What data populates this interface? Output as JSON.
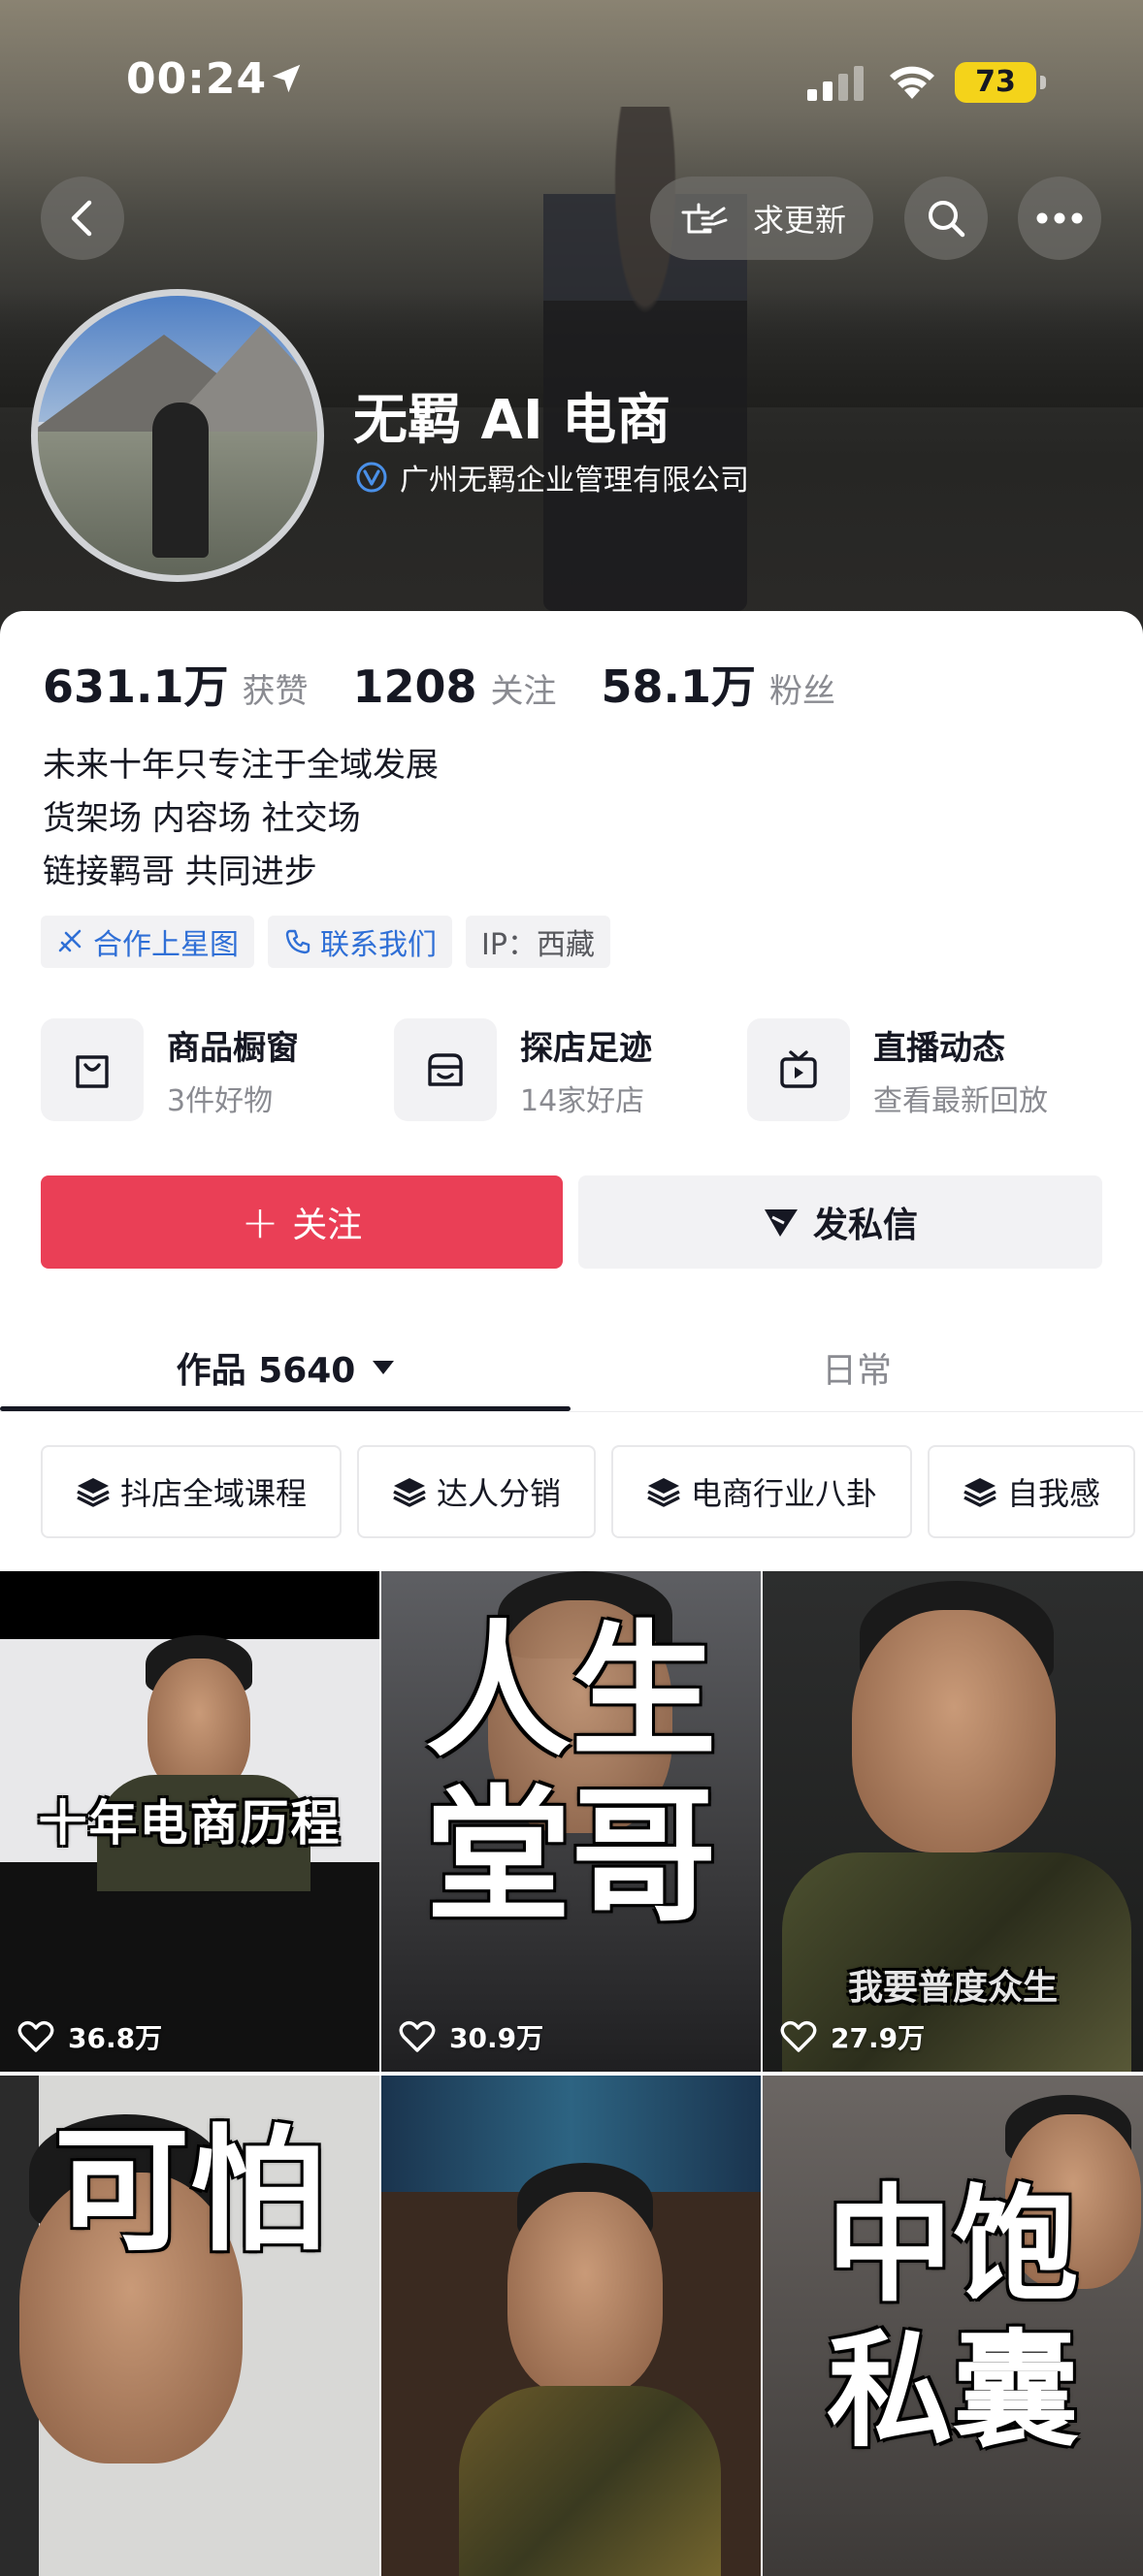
{
  "status_bar": {
    "time": "00:24",
    "battery": "73"
  },
  "header": {
    "update_label": "求更新"
  },
  "profile": {
    "name": "无羁 AI 电商",
    "company": "广州无羁企业管理有限公司",
    "stats": [
      {
        "value": "631.1万",
        "label": "获赞"
      },
      {
        "value": "1208",
        "label": "关注"
      },
      {
        "value": "58.1万",
        "label": "粉丝"
      }
    ],
    "bio": [
      "未来十年只专注于全域发展",
      "货架场 内容场 社交场",
      "链接羁哥 共同进步"
    ],
    "tags": {
      "collab": "合作上星图",
      "contact": "联系我们",
      "ip": "IP：西藏"
    }
  },
  "services": [
    {
      "title": "商品橱窗",
      "sub": "3件好物",
      "icon": "bag-icon"
    },
    {
      "title": "探店足迹",
      "sub": "14家好店",
      "icon": "shop-icon"
    },
    {
      "title": "直播动态",
      "sub": "查看最新回放",
      "icon": "tv-icon"
    }
  ],
  "actions": {
    "follow": "关注",
    "message": "发私信"
  },
  "tabs": {
    "works": "作品 5640",
    "daily": "日常"
  },
  "collections": [
    "抖店全域课程",
    "达人分销",
    "电商行业八卦",
    "自我感"
  ],
  "videos": [
    {
      "likes": "36.8万",
      "overlay": "十年电商历程"
    },
    {
      "likes": "30.9万",
      "overlay": "人生 堂哥"
    },
    {
      "likes": "27.9万",
      "overlay": "我要普度众生"
    },
    {
      "likes": "",
      "overlay": "可怕"
    },
    {
      "likes": "",
      "overlay": ""
    },
    {
      "likes": "",
      "overlay": "中饱 私囊"
    }
  ],
  "colors": {
    "accent": "#ea3f56",
    "link_blue": "#2f6fd6",
    "battery": "#f4d31a"
  }
}
